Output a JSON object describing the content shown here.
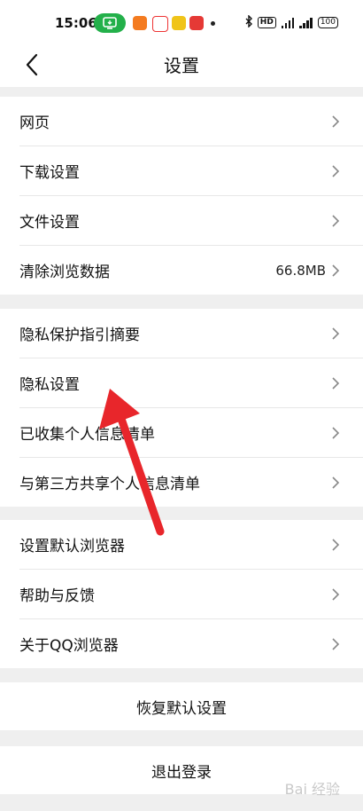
{
  "statusbar": {
    "time": "15:06",
    "hd_label": "HD",
    "battery": "100"
  },
  "header": {
    "title": "设置"
  },
  "groups": [
    {
      "items": [
        {
          "label": "网页"
        },
        {
          "label": "下载设置"
        },
        {
          "label": "文件设置"
        },
        {
          "label": "清除浏览数据",
          "value": "66.8MB"
        }
      ]
    },
    {
      "items": [
        {
          "label": "隐私保护指引摘要"
        },
        {
          "label": "隐私设置"
        },
        {
          "label": "已收集个人信息清单"
        },
        {
          "label": "与第三方共享个人信息清单"
        }
      ]
    },
    {
      "items": [
        {
          "label": "设置默认浏览器"
        },
        {
          "label": "帮助与反馈"
        },
        {
          "label": "关于QQ浏览器"
        }
      ]
    }
  ],
  "actions": {
    "restore_defaults": "恢复默认设置",
    "logout": "退出登录"
  },
  "watermark": "Bai 经验",
  "colors": {
    "arrow": "#e8262b",
    "status_pill": "#23b04a",
    "background": "#efefef"
  }
}
